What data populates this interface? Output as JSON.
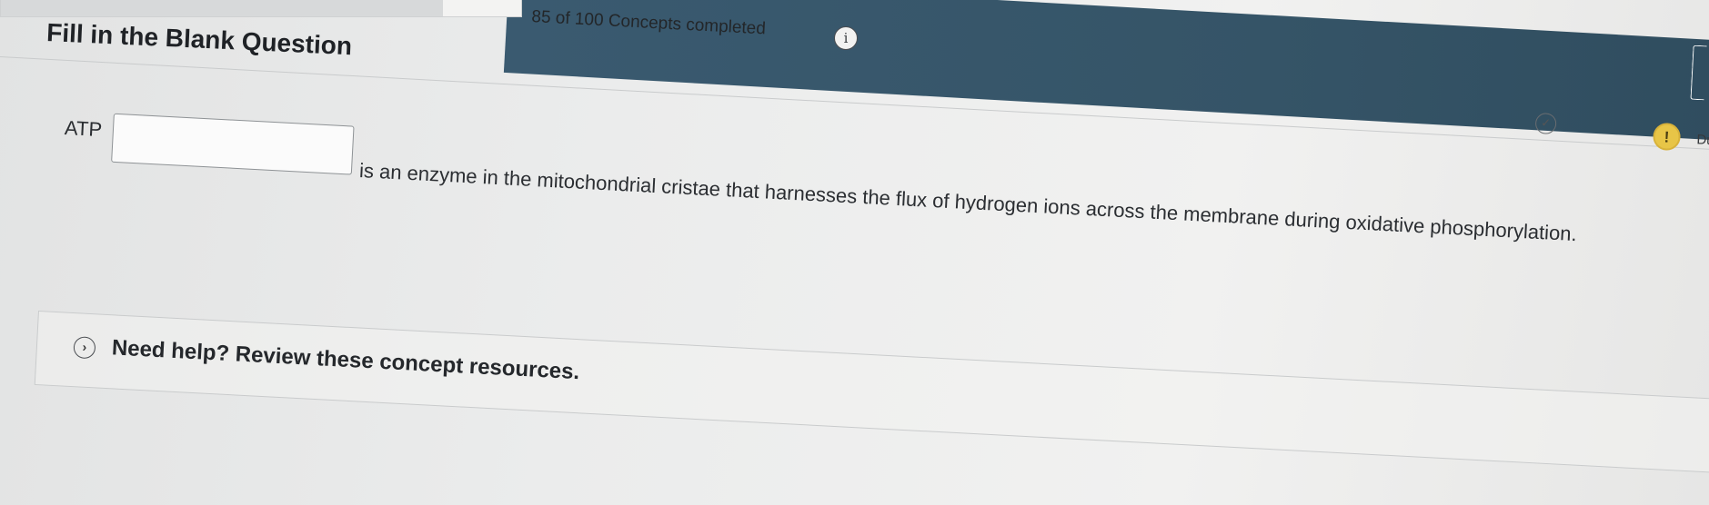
{
  "progress": {
    "completed": 85,
    "total": 100,
    "text": "85 of 100 Concepts completed",
    "info_glyph": "i"
  },
  "question": {
    "heading": "Fill in the Blank Question",
    "prefix": "ATP",
    "blank_value": "",
    "suffix": "is an enzyme in the mitochondrial cristae that harnesses the flux of hydrogen ions across the membrane during oxidative phosphorylation."
  },
  "help": {
    "label": "Need help? Review these concept resources."
  },
  "side": {
    "cut_text": "Du",
    "alert_glyph": "!"
  },
  "colors": {
    "banner": "#355467",
    "alert": "#e8c547",
    "background": "#e9eaea"
  },
  "icons": [
    "info-icon",
    "chevron-right-icon",
    "check-circle-icon",
    "alert-icon"
  ]
}
